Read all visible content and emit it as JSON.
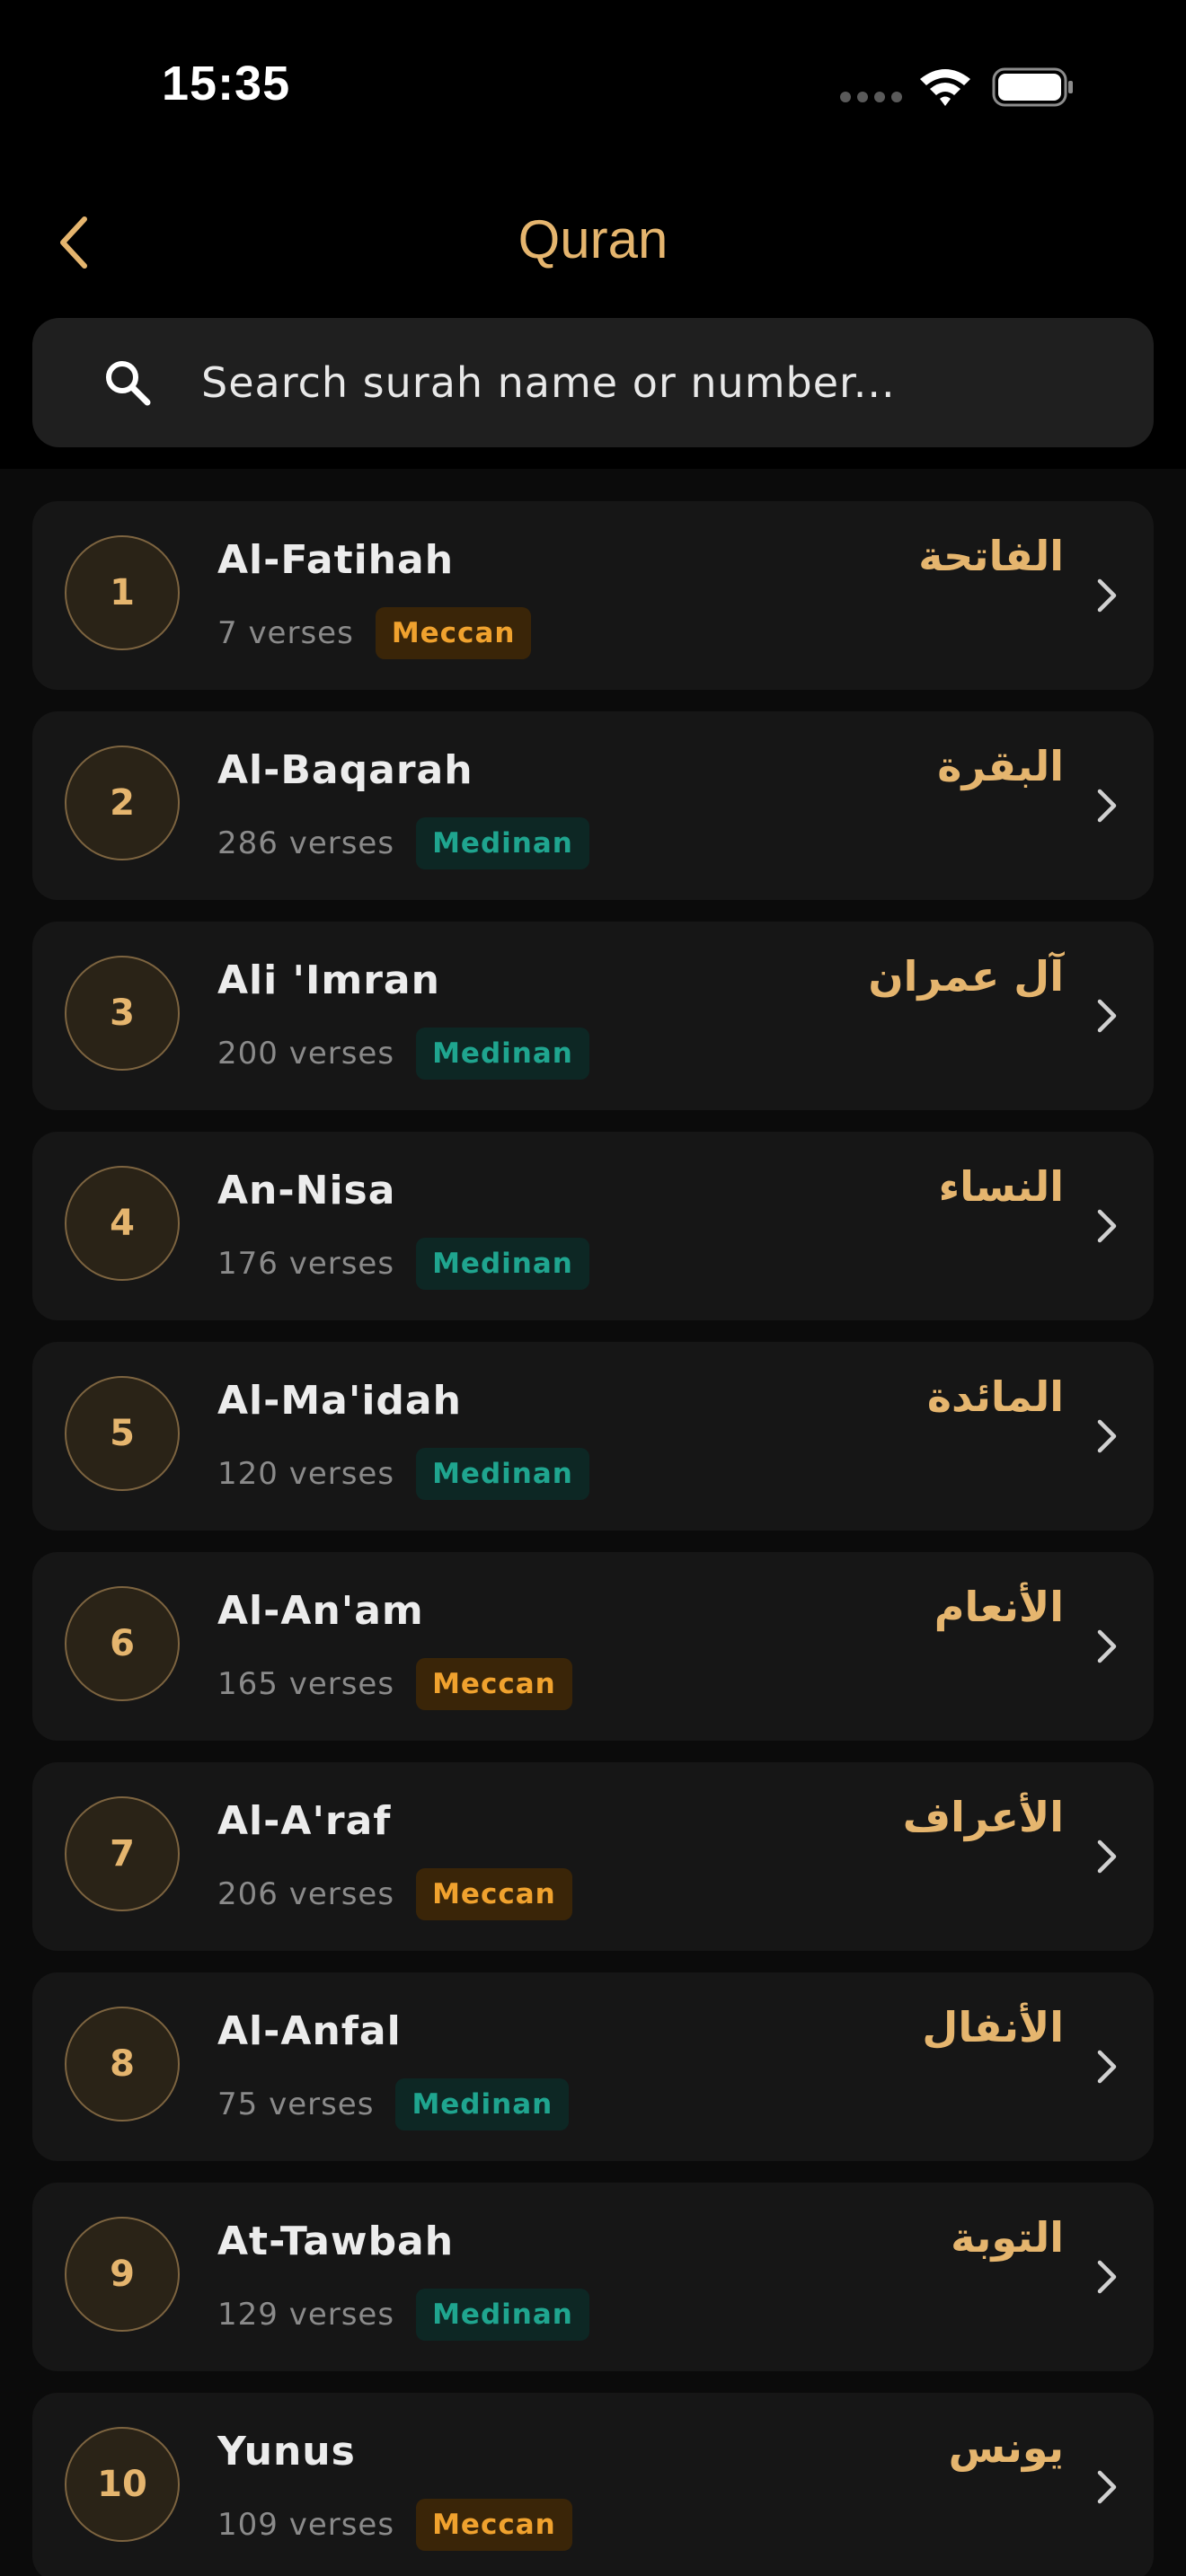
{
  "status_bar": {
    "time": "15:35"
  },
  "header": {
    "title": "Quran",
    "back_icon": "chevron-left-icon"
  },
  "search": {
    "placeholder": "Search surah name or number...",
    "icon": "search-icon"
  },
  "colors": {
    "accent": "#e5b56e",
    "meccan_text": "#f0a22e",
    "meccan_bg": "#3a2508",
    "medinan_text": "#1fa58f",
    "medinan_bg": "#0d2724",
    "card_bg": "#161616",
    "screen_bg": "#000000"
  },
  "surahs": [
    {
      "number": "1",
      "name": "Al-Fatihah",
      "arabic": "الفاتحة",
      "verses": "7 verses",
      "type": "Meccan"
    },
    {
      "number": "2",
      "name": "Al-Baqarah",
      "arabic": "البقرة",
      "verses": "286 verses",
      "type": "Medinan"
    },
    {
      "number": "3",
      "name": "Ali 'Imran",
      "arabic": "آل عمران",
      "verses": "200 verses",
      "type": "Medinan"
    },
    {
      "number": "4",
      "name": "An-Nisa",
      "arabic": "النساء",
      "verses": "176 verses",
      "type": "Medinan"
    },
    {
      "number": "5",
      "name": "Al-Ma'idah",
      "arabic": "المائدة",
      "verses": "120 verses",
      "type": "Medinan"
    },
    {
      "number": "6",
      "name": "Al-An'am",
      "arabic": "الأنعام",
      "verses": "165 verses",
      "type": "Meccan"
    },
    {
      "number": "7",
      "name": "Al-A'raf",
      "arabic": "الأعراف",
      "verses": "206 verses",
      "type": "Meccan"
    },
    {
      "number": "8",
      "name": "Al-Anfal",
      "arabic": "الأنفال",
      "verses": "75 verses",
      "type": "Medinan"
    },
    {
      "number": "9",
      "name": "At-Tawbah",
      "arabic": "التوبة",
      "verses": "129 verses",
      "type": "Medinan"
    },
    {
      "number": "10",
      "name": "Yunus",
      "arabic": "يونس",
      "verses": "109 verses",
      "type": "Meccan"
    }
  ]
}
